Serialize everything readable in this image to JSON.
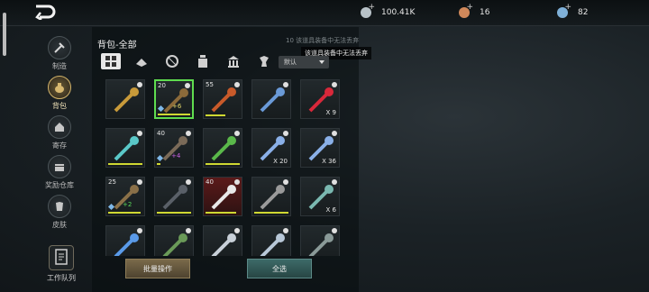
{
  "currencies": [
    {
      "icon": "silver-coin-icon",
      "value": "100.41K",
      "color": "#b8c2c8"
    },
    {
      "icon": "gold-coin-icon",
      "value": "16",
      "color": "#d0885a"
    },
    {
      "icon": "gem-coin-icon",
      "value": "82",
      "color": "#7fb0d8"
    }
  ],
  "sidebar": [
    {
      "label": "制造",
      "icon": "hammer-icon"
    },
    {
      "label": "背包",
      "icon": "bag-icon",
      "active": true
    },
    {
      "label": "寄存",
      "icon": "house-icon"
    },
    {
      "label": "奖励仓库",
      "icon": "chest-icon"
    },
    {
      "label": "皮肤",
      "icon": "armor-icon"
    }
  ],
  "worklist_label": "工作队列",
  "panel_title": "背包-全部",
  "hint_faded": "该道具装备中无法丢弃",
  "hint_faded_num": "10",
  "hint_tooltip": "该道具装备中无法丢弃",
  "sort_label": "默认",
  "filters": [
    "all-filter-icon",
    "material-filter-icon",
    "orb-filter-icon",
    "potion-filter-icon",
    "building-filter-icon",
    "pet-filter-icon"
  ],
  "items": [
    {
      "name": "shield-amulet",
      "color": "#c89a3a",
      "bar": "#cfd832",
      "barw": 0
    },
    {
      "name": "staff",
      "color": "#8b6a3a",
      "lvl": "20",
      "plus": "+6",
      "plusColor": "#e5d86a",
      "sel": true,
      "bar": "#cfd832",
      "barw": 0.9
    },
    {
      "name": "fire-staff",
      "color": "#c85a2a",
      "lvl": "55",
      "bar": "#cfd832",
      "barw": 0.55
    },
    {
      "name": "crystal-spear",
      "color": "#6a9ad8"
    },
    {
      "name": "red-dust",
      "color": "#d8283a",
      "cnt": "X 9"
    },
    {
      "name": "ice-spear",
      "color": "#5ac8c8",
      "bar": "#cfd832",
      "barw": 0.95
    },
    {
      "name": "bow",
      "color": "#7a6a58",
      "lvl": "40",
      "plus": "+4",
      "plusColor": "#c860e0",
      "bar": "#cfd832",
      "barw": 0.1
    },
    {
      "name": "green-potion",
      "color": "#5ab84a",
      "bar": "#cfd832",
      "barw": 0.95
    },
    {
      "name": "crystal-bolt",
      "color": "#8ab0e8",
      "cnt": "X 20"
    },
    {
      "name": "crystal-arrow",
      "color": "#8ab0e8",
      "cnt": "X 36"
    },
    {
      "name": "spear",
      "color": "#8a7048",
      "lvl": "25",
      "plus": "+2",
      "plusColor": "#5ad85a",
      "bar": "#cfd832",
      "barw": 0.9
    },
    {
      "name": "dark-bow",
      "color": "#5a6068",
      "bar": "#cfd832",
      "barw": 0.95
    },
    {
      "name": "crossed-hammer",
      "color": "#e8e8e8",
      "lvl": "40",
      "red": true,
      "bar": "#cfd832",
      "barw": 0.85
    },
    {
      "name": "dark-axe",
      "color": "#9a9a9a",
      "bar": "#cfd832",
      "barw": 0.95
    },
    {
      "name": "crystal-shield",
      "color": "#7ab8b0",
      "cnt": "X 6"
    },
    {
      "name": "ice-crystal",
      "color": "#5a9ae8"
    },
    {
      "name": "helmet",
      "color": "#6a9a58"
    },
    {
      "name": "silver-axe",
      "color": "#c8d0d8"
    },
    {
      "name": "stone-ball",
      "color": "#b8c8d8"
    },
    {
      "name": "pickaxe",
      "color": "#8a9a98"
    }
  ],
  "batch_label": "批量操作",
  "select_all_label": "全选"
}
